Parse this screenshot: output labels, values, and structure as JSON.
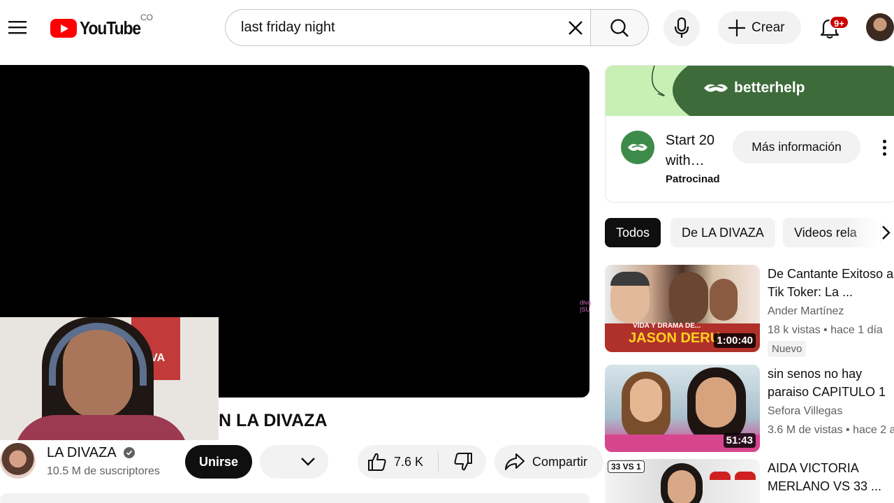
{
  "header": {
    "logo_text": "YouTube",
    "country_code": "CO",
    "search_value": "last friday night",
    "create_label": "Crear",
    "notification_count": "9+"
  },
  "player": {
    "watermark": "diva\n|SU"
  },
  "video": {
    "title_fragment": "N LA DIVAZA",
    "channel_name": "LA DIVAZA",
    "subscribers": "10.5 M de suscriptores",
    "join_label": "Unirse",
    "likes": "7.6 K",
    "share_label": "Compartir"
  },
  "ad": {
    "brand": "betterhelp",
    "text": "Start 20 with…",
    "sponsored": "Patrocinad",
    "cta": "Más información"
  },
  "chips": [
    {
      "label": "Todos",
      "active": true
    },
    {
      "label": "De LA DIVAZA",
      "active": false
    },
    {
      "label": "Videos rela",
      "active": false
    }
  ],
  "related": [
    {
      "title": "De Cantante Exitoso a Tik Toker: La ...",
      "channel": "Ander Martínez",
      "meta": "18 k vistas • hace 1 día",
      "badge": "Nuevo",
      "duration": "1:00:40",
      "thumb_text1": "VIDA Y DRAMA DE...",
      "thumb_text2": "JASON DERU"
    },
    {
      "title": "sin senos no hay paraiso CAPITULO 1",
      "channel": "Sefora Villegas",
      "meta": "3.6 M de vistas • hace 2 a",
      "duration": "51:43"
    },
    {
      "title": "AIDA VICTORIA MERLANO VS 33 ...",
      "thumb_text1": "33 VS 1"
    }
  ],
  "colors": {
    "brand_red": "#ff0000",
    "text_primary": "#0f0f0f",
    "text_secondary": "#606060",
    "chip_bg": "#f2f2f2",
    "ad_green": "#3d6b3a"
  }
}
